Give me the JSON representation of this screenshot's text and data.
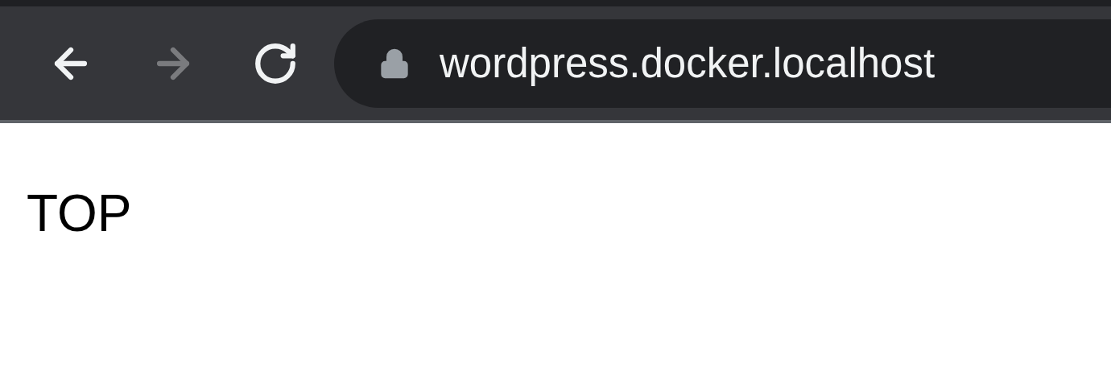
{
  "toolbar": {
    "buttons": [
      {
        "kind": "back",
        "disabled": false
      },
      {
        "kind": "forward",
        "disabled": true
      },
      {
        "kind": "reload",
        "disabled": false
      }
    ]
  },
  "address_bar": {
    "url": "wordpress.docker.localhost",
    "secure": true
  },
  "page": {
    "heading": "TOP"
  }
}
